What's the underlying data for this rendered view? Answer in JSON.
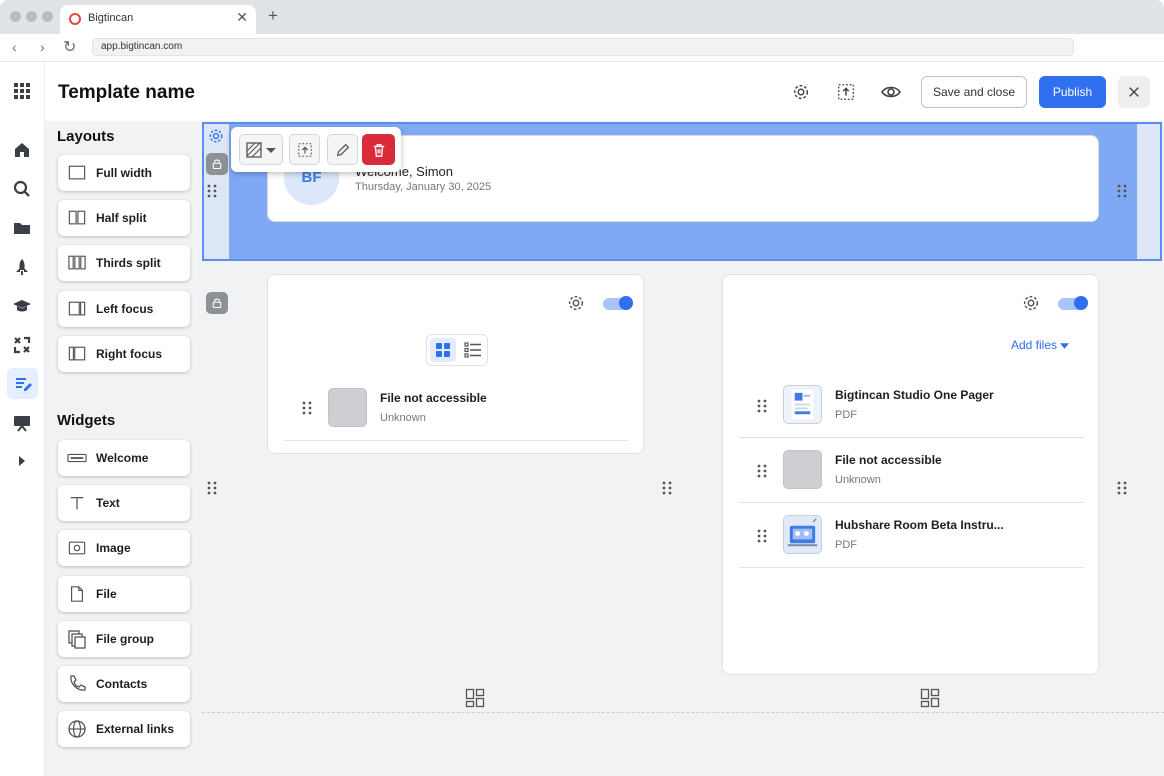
{
  "browser": {
    "tab_title": "Bigtincan",
    "url": "app.bigtincan.com"
  },
  "header": {
    "title": "Template name",
    "save_label": "Save and close",
    "publish_label": "Publish"
  },
  "panel": {
    "layouts_heading": "Layouts",
    "layouts": [
      {
        "label": "Full width",
        "icon": "full-width-layout-icon"
      },
      {
        "label": "Half split",
        "icon": "half-split-layout-icon"
      },
      {
        "label": "Thirds split",
        "icon": "thirds-split-layout-icon"
      },
      {
        "label": "Left focus",
        "icon": "left-focus-layout-icon"
      },
      {
        "label": "Right focus",
        "icon": "right-focus-layout-icon"
      }
    ],
    "widgets_heading": "Widgets",
    "widgets": [
      {
        "label": "Welcome",
        "icon": "welcome-widget-icon"
      },
      {
        "label": "Text",
        "icon": "text-widget-icon"
      },
      {
        "label": "Image",
        "icon": "image-widget-icon"
      },
      {
        "label": "File",
        "icon": "file-widget-icon"
      },
      {
        "label": "File group",
        "icon": "file-group-widget-icon"
      },
      {
        "label": "Contacts",
        "icon": "contacts-widget-icon"
      },
      {
        "label": "External links",
        "icon": "external-links-widget-icon"
      }
    ]
  },
  "welcome": {
    "initials": "BF",
    "greeting": "Welcome, Simon",
    "date": "Thursday, January 30, 2025"
  },
  "left_card": {
    "files": [
      {
        "name": "File not accessible",
        "meta": "Unknown"
      }
    ]
  },
  "right_card": {
    "add_files_label": "Add files",
    "files": [
      {
        "name": "Bigtincan Studio One Pager",
        "meta": "PDF"
      },
      {
        "name": "File not accessible",
        "meta": "Unknown"
      },
      {
        "name": "Hubshare Room Beta Instru...",
        "meta": "PDF"
      }
    ]
  },
  "colors": {
    "accent": "#2f6ff0",
    "selection": "#7fa8f5",
    "delete": "#d92b3a"
  }
}
